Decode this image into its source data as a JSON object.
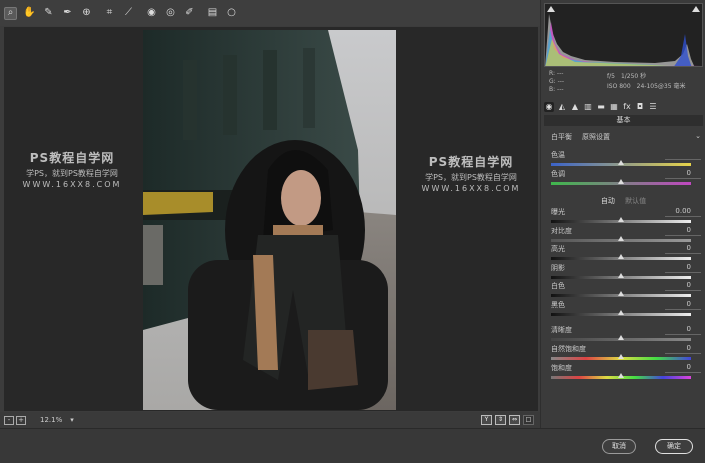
{
  "toolbar": {
    "tools": [
      {
        "icon": "zoom-icon",
        "glyph": "⌕",
        "active": true
      },
      {
        "icon": "hand-icon",
        "glyph": "✋"
      },
      {
        "icon": "white-balance-icon",
        "glyph": "✎"
      },
      {
        "icon": "color-sampler-icon",
        "glyph": "✒"
      },
      {
        "icon": "targeted-adjustment-icon",
        "glyph": "⊕"
      },
      {
        "icon": "crop-icon",
        "glyph": "⌗"
      },
      {
        "icon": "straighten-icon",
        "glyph": "⟋"
      },
      {
        "icon": "spot-removal-icon",
        "glyph": "◉"
      },
      {
        "icon": "red-eye-icon",
        "glyph": "◎"
      },
      {
        "icon": "adjustment-brush-icon",
        "glyph": "✐"
      },
      {
        "icon": "graduated-filter-icon",
        "glyph": "▤"
      },
      {
        "icon": "radial-filter-icon",
        "glyph": "○"
      }
    ]
  },
  "watermark": {
    "title": "PS教程自学网",
    "subtitle": "学PS，就到PS教程自学网",
    "url": "WWW.16XX8.COM"
  },
  "canvas_bottom": {
    "zoom_value": "12.1%",
    "zoom_dropdown": "▾",
    "view_buttons": [
      "Y",
      "⇕",
      "⇔",
      "□"
    ]
  },
  "footer": {
    "cancel_label": "取消",
    "ok_label": "确定"
  },
  "histogram": {
    "rgb_labels": [
      "R: ---",
      "G: ---",
      "B: ---"
    ],
    "camera": {
      "aperture": "f/5",
      "shutter": "1/250 秒",
      "iso": "ISO 800",
      "lens": "24-105@35 毫米"
    }
  },
  "panel": {
    "section_title": "基本",
    "white_balance": {
      "label": "白平衡",
      "value": "原照设置",
      "arrow": "⌄"
    },
    "auto_label": "自动",
    "default_label": "默认值",
    "sliders_top": [
      {
        "name": "temperature",
        "label": "色温",
        "value": "",
        "pos": 0.5,
        "gradient": "linear-gradient(90deg,#3b63c9,#e6d34a)"
      },
      {
        "name": "tint",
        "label": "色调",
        "value": "0",
        "pos": 0.5,
        "gradient": "linear-gradient(90deg,#3fb84c,#c047c0)"
      }
    ],
    "sliders_tone": [
      {
        "name": "exposure",
        "label": "曝光",
        "value": "0.00",
        "pos": 0.5,
        "gradient": "linear-gradient(90deg,#111,#eee)"
      },
      {
        "name": "contrast",
        "label": "对比度",
        "value": "0",
        "pos": 0.5,
        "gradient": "linear-gradient(90deg,#555,#999)"
      },
      {
        "name": "highlights",
        "label": "高光",
        "value": "0",
        "pos": 0.5,
        "gradient": "linear-gradient(90deg,#111,#eee)"
      },
      {
        "name": "shadows",
        "label": "阴影",
        "value": "0",
        "pos": 0.5,
        "gradient": "linear-gradient(90deg,#111,#eee)"
      },
      {
        "name": "whites",
        "label": "白色",
        "value": "0",
        "pos": 0.5,
        "gradient": "linear-gradient(90deg,#111,#eee)"
      },
      {
        "name": "blacks",
        "label": "黑色",
        "value": "0",
        "pos": 0.5,
        "gradient": "linear-gradient(90deg,#111,#eee)"
      }
    ],
    "sliders_presence": [
      {
        "name": "clarity",
        "label": "清晰度",
        "value": "0",
        "pos": 0.5,
        "gradient": "linear-gradient(90deg,#444,#888)"
      },
      {
        "name": "vibrance",
        "label": "自然饱和度",
        "value": "0",
        "pos": 0.5,
        "gradient": "linear-gradient(90deg,#888,#d44,#dd4,#4d4,#44d)"
      },
      {
        "name": "saturation",
        "label": "饱和度",
        "value": "0",
        "pos": 0.5,
        "gradient": "linear-gradient(90deg,#777,#d44,#dd4,#4d4,#44d,#d4d)"
      }
    ]
  }
}
